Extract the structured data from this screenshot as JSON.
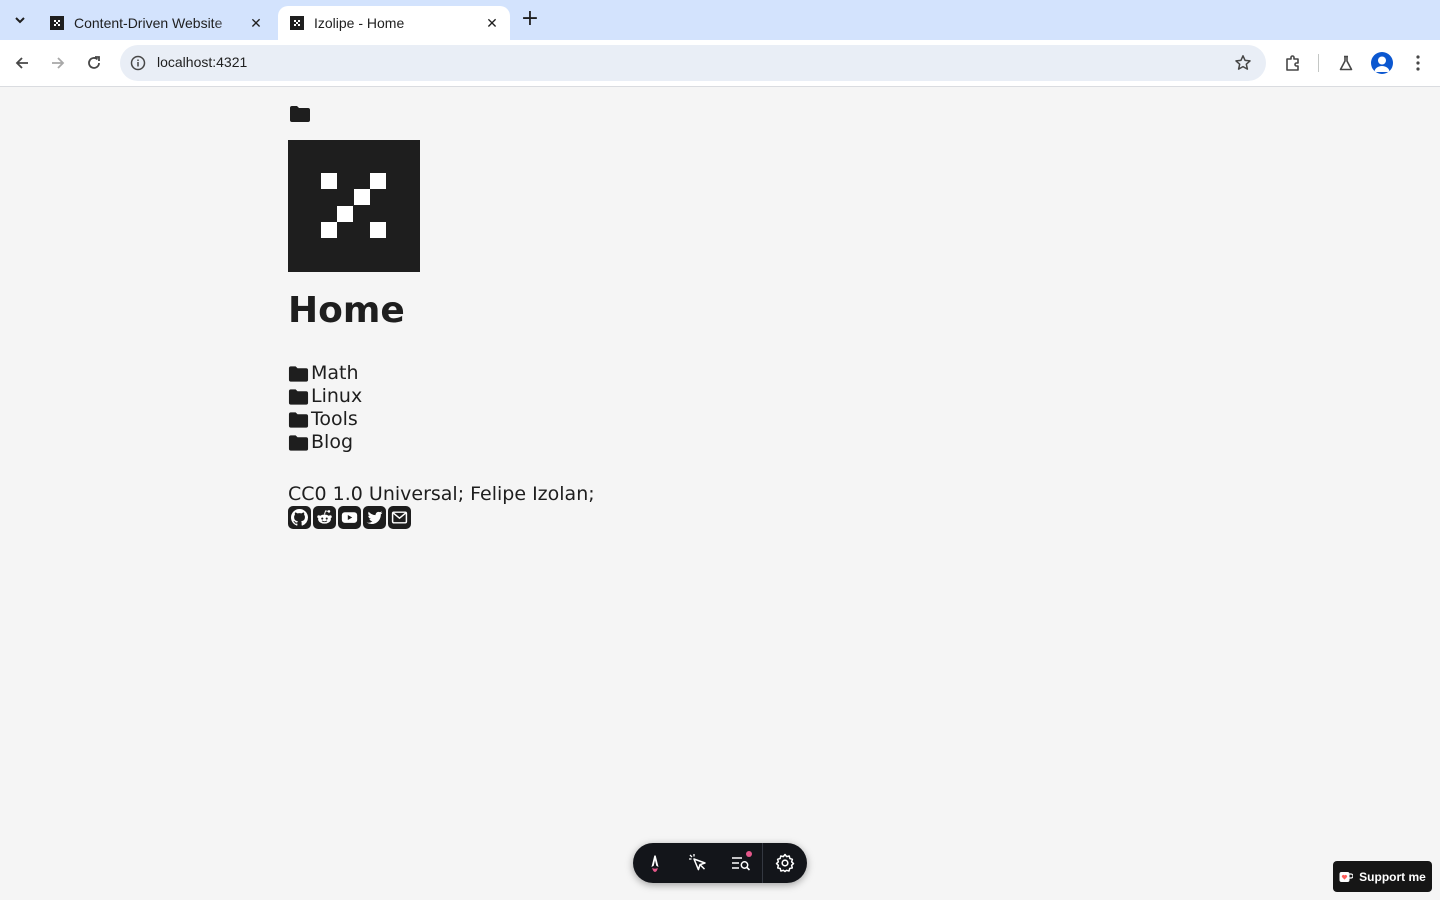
{
  "browser": {
    "tabs": [
      {
        "title": "Content-Driven Website",
        "active": false
      },
      {
        "title": "Izolipe - Home",
        "active": true
      }
    ],
    "close_glyph": "✕",
    "new_tab_glyph": "+",
    "url": "localhost:4321"
  },
  "page": {
    "title": "Home",
    "folders": [
      "Math",
      "Linux",
      "Tools",
      "Blog"
    ],
    "license": "CC0 1.0 Universal; Felipe Izolan;",
    "socials": [
      "github-icon",
      "reddit-icon",
      "youtube-icon",
      "twitter-icon",
      "email-icon"
    ]
  },
  "devbar": {
    "buttons": [
      "astro-menu-icon",
      "inspect-icon",
      "audit-icon",
      "settings-icon"
    ],
    "accent": "#e5578a"
  },
  "support": {
    "label": "Support me"
  }
}
